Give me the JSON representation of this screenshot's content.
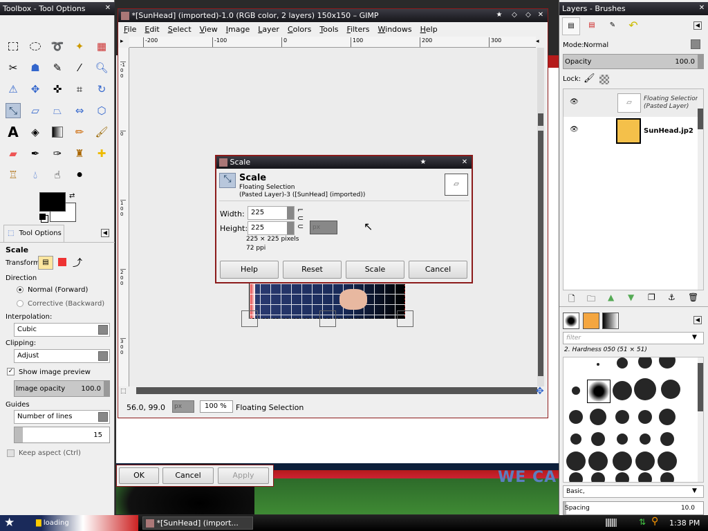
{
  "toolbox": {
    "title": "Toolbox - Tool Options",
    "tool_options_tab": "Tool Options",
    "tool_name": "Scale",
    "transform_label": "Transform:",
    "direction_label": "Direction",
    "direction_normal": "Normal (Forward)",
    "direction_corrective": "Corrective (Backward)",
    "interpolation_label": "Interpolation:",
    "interpolation_value": "Cubic",
    "clipping_label": "Clipping:",
    "clipping_value": "Adjust",
    "show_preview_label": "Show image preview",
    "image_opacity_label": "Image opacity",
    "image_opacity_value": "100.0",
    "guides_label": "Guides",
    "guides_value": "Number of lines",
    "guides_count": "15",
    "keep_aspect_label": "Keep aspect  (Ctrl)"
  },
  "gimp": {
    "title": "*[SunHead] (imported)-1.0 (RGB color, 2 layers) 150x150 – GIMP",
    "menu": [
      "File",
      "Edit",
      "Select",
      "View",
      "Image",
      "Layer",
      "Colors",
      "Tools",
      "Filters",
      "Windows",
      "Help"
    ],
    "ruler_h": [
      "-200",
      "-100",
      "0",
      "100",
      "200",
      "300"
    ],
    "ruler_v": [
      "-100",
      "0",
      "100",
      "200",
      "300"
    ],
    "coords": "56.0, 99.0",
    "unit": "px",
    "zoom": "100 %",
    "status": "Floating Selection"
  },
  "scale_dialog": {
    "title": "Scale",
    "heading": "Scale",
    "subheading": "Floating Selection",
    "layer_info": "(Pasted Layer)-3 ([SunHead] (imported))",
    "width_label": "Width:",
    "width_value": "225",
    "height_label": "Height:",
    "height_value": "225",
    "unit": "px",
    "size_text": "225 × 225 pixels",
    "resolution_text": "72 ppi",
    "help_button": "Help",
    "reset_button": "Reset",
    "scale_button": "Scale",
    "cancel_button": "Cancel"
  },
  "bottom_dialog": {
    "ok": "OK",
    "cancel": "Cancel",
    "apply": "Apply"
  },
  "background_text": "WE CA",
  "layers": {
    "title": "Layers - Brushes",
    "mode_label": "Mode:",
    "mode_value": "Normal",
    "opacity_label": "Opacity",
    "opacity_value": "100.0",
    "lock_label": "Lock:",
    "items": [
      {
        "name": "Floating Selection\n(Pasted Layer)"
      },
      {
        "name": "SunHead.jp2"
      }
    ]
  },
  "brushes": {
    "filter_placeholder": "filter",
    "current_brush": "2. Hardness 050 (51 × 51)",
    "preset": "Basic,",
    "spacing_label": "Spacing",
    "spacing_value": "10.0"
  },
  "taskbar": {
    "task1": "loading",
    "task2": "*[SunHead] (import...",
    "clock": "1:38 PM"
  },
  "colors": {
    "accent_red": "#8b1a1a",
    "title_dark": "#1e1e24",
    "selection_blue": "#b8c7dc",
    "sun_yellow": "#f4c04a"
  }
}
